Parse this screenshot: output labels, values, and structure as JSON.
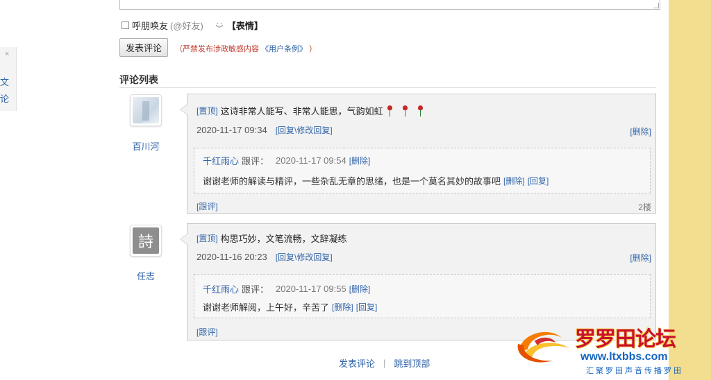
{
  "compose": {
    "mention_label": "呼朋唤友",
    "mention_hint": "(@好友)",
    "emoji_label": "【表情】",
    "submit_label": "发表评论",
    "warning_prefix": "（严禁发布涉政敏感内容",
    "terms_link": "《用户条例》",
    "warning_suffix": "）"
  },
  "left_panel": {
    "close": "×",
    "chars": [
      "文",
      "论"
    ]
  },
  "comments_section": {
    "title": "评论列表",
    "comments": [
      {
        "username": "百川河",
        "pin_label": "[置顶]",
        "text": "这诗非常人能写、非常人能思，气韵如虹",
        "date": "2020-11-17 09:34",
        "reply_edit_label": "[回复\\修改回复]",
        "delete_label": "[删除]",
        "follow_label": "[跟评]",
        "floor": "2楼",
        "reply": {
          "author": "千红雨心",
          "label": "跟评：",
          "date": "2020-11-17 09:54",
          "delete_label": "[删除]",
          "text": "谢谢老师的解读与精评，一些杂乱无章的思绪，也是一个莫名其妙的故事吧",
          "delete2_label": "[删除]",
          "reply_label": "[回复]"
        }
      },
      {
        "username": "任志",
        "avatar_char": "詩",
        "pin_label": "[置顶]",
        "text": "构思巧妙，文笔流畅，文辞凝练",
        "date": "2020-11-16 20:23",
        "reply_edit_label": "[回复\\修改回复]",
        "delete_label": "[删除]",
        "follow_label": "[跟评]",
        "reply": {
          "author": "千红雨心",
          "label": "跟评：",
          "date": "2020-11-17 09:55",
          "delete_label": "[删除]",
          "text": "谢谢老师解阅，上午好，辛苦了",
          "delete2_label": "[删除]",
          "reply_label": "[回复]"
        }
      }
    ]
  },
  "footer": {
    "post_comment": "发表评论",
    "separator": "|",
    "back_to_top": "跳到顶部"
  },
  "watermark": {
    "title": "罗罗田论坛",
    "url": "www.ltxbbs.com",
    "tagline": "汇聚罗田声音传播罗田"
  },
  "colors": {
    "link": "#3366aa",
    "warning": "#c0392b",
    "side_band": "#f3dd8f"
  }
}
